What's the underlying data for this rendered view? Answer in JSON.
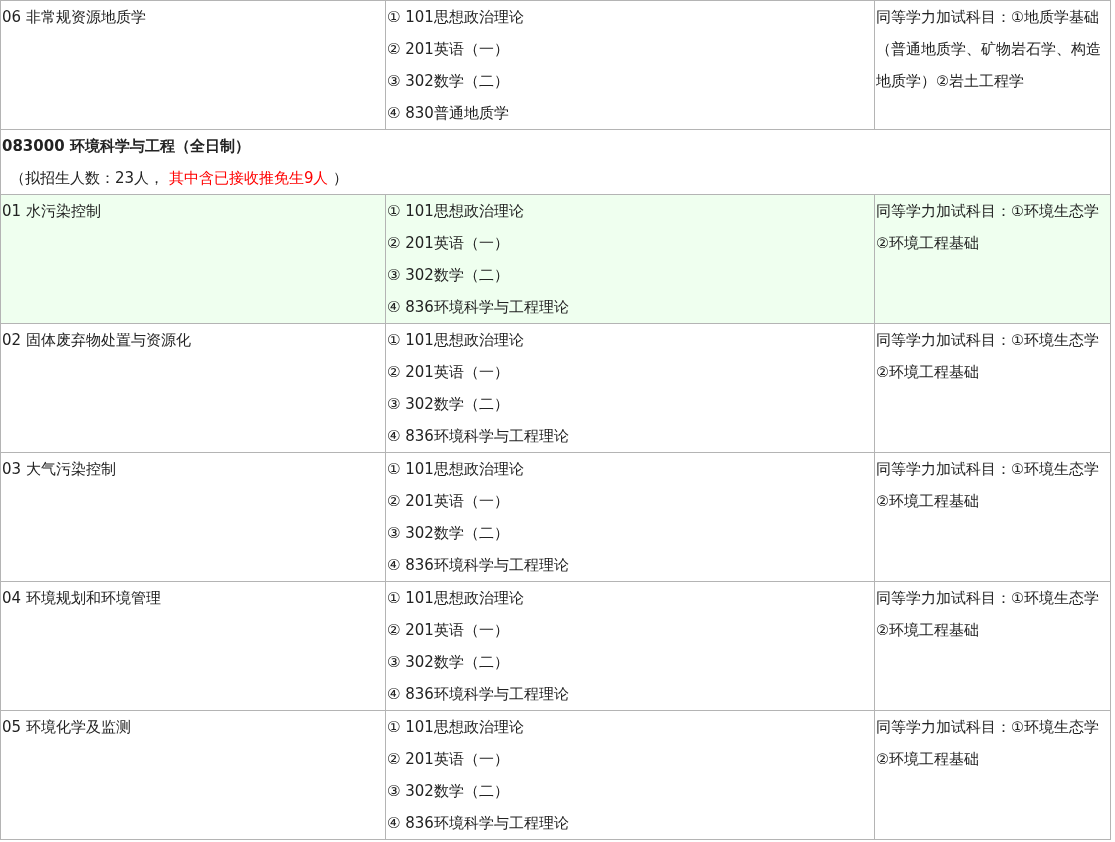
{
  "rows": [
    {
      "kind": "direction",
      "name": "06 非常规资源地质学",
      "subjects": [
        "① 101思想政治理论",
        "② 201英语（一）",
        "③ 302数学（二）",
        "④ 830普通地质学"
      ],
      "note": "同等学力加试科目：①地质学基础（普通地质学、矿物岩石学、构造地质学）②岩土工程学",
      "highlighted": false
    },
    {
      "kind": "major",
      "title": "083000 环境科学与工程（全日制）",
      "quota": "（拟招生人数：23人，",
      "quota_note": "其中含已接收推免生9人",
      "quota_end": "）"
    },
    {
      "kind": "direction",
      "name": "01 水污染控制",
      "subjects": [
        "① 101思想政治理论",
        "② 201英语（一）",
        "③ 302数学（二）",
        "④ 836环境科学与工程理论"
      ],
      "note": "同等学力加试科目：①环境生态学 ②环境工程基础",
      "highlighted": true
    },
    {
      "kind": "direction",
      "name": "02 固体废弃物处置与资源化",
      "subjects": [
        "① 101思想政治理论",
        "② 201英语（一）",
        "③ 302数学（二）",
        "④ 836环境科学与工程理论"
      ],
      "note": "同等学力加试科目：①环境生态学 ②环境工程基础",
      "highlighted": false
    },
    {
      "kind": "direction",
      "name": "03 大气污染控制",
      "subjects": [
        "① 101思想政治理论",
        "② 201英语（一）",
        "③ 302数学（二）",
        "④ 836环境科学与工程理论"
      ],
      "note": "同等学力加试科目：①环境生态学 ②环境工程基础",
      "highlighted": false
    },
    {
      "kind": "direction",
      "name": "04 环境规划和环境管理",
      "subjects": [
        "① 101思想政治理论",
        "② 201英语（一）",
        "③ 302数学（二）",
        "④ 836环境科学与工程理论"
      ],
      "note": "同等学力加试科目：①环境生态学 ②环境工程基础",
      "highlighted": false
    },
    {
      "kind": "direction",
      "name": "05 环境化学及监测",
      "subjects": [
        "① 101思想政治理论",
        "② 201英语（一）",
        "③ 302数学（二）",
        "④ 836环境科学与工程理论"
      ],
      "note": "同等学力加试科目：①环境生态学 ②环境工程基础",
      "highlighted": false
    }
  ]
}
